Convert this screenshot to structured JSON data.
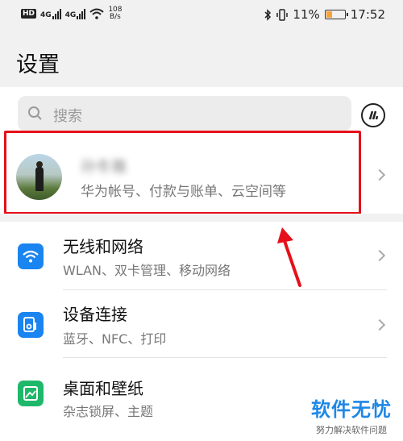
{
  "status_bar": {
    "hd_label": "HD",
    "network_1": "4G",
    "network_2": "4G",
    "speed_value": "108",
    "speed_unit": "B/s",
    "battery_text": "11%",
    "battery_level": 0.11,
    "time": "17:52"
  },
  "page": {
    "title": "设置"
  },
  "search": {
    "placeholder": "搜索"
  },
  "account": {
    "name": "孙冬雅",
    "subtitle": "华为帐号、付款与账单、云空间等"
  },
  "menu": [
    {
      "title": "无线和网络",
      "subtitle": "WLAN、双卡管理、移动网络",
      "icon": "wifi-icon",
      "color": "#1a84f0"
    },
    {
      "title": "设备连接",
      "subtitle": "蓝牙、NFC、打印",
      "icon": "device-connection-icon",
      "color": "#1a84f0"
    },
    {
      "title": "桌面和壁纸",
      "subtitle": "杂志锁屏、主题",
      "icon": "wallpaper-icon",
      "color": "#1fb86a"
    }
  ],
  "watermark": {
    "main": "软件无忧",
    "sub": "努力解决软件问题"
  },
  "colors": {
    "highlight": "#e5101a",
    "accent_blue": "#1a84f0",
    "accent_green": "#1fb86a"
  }
}
